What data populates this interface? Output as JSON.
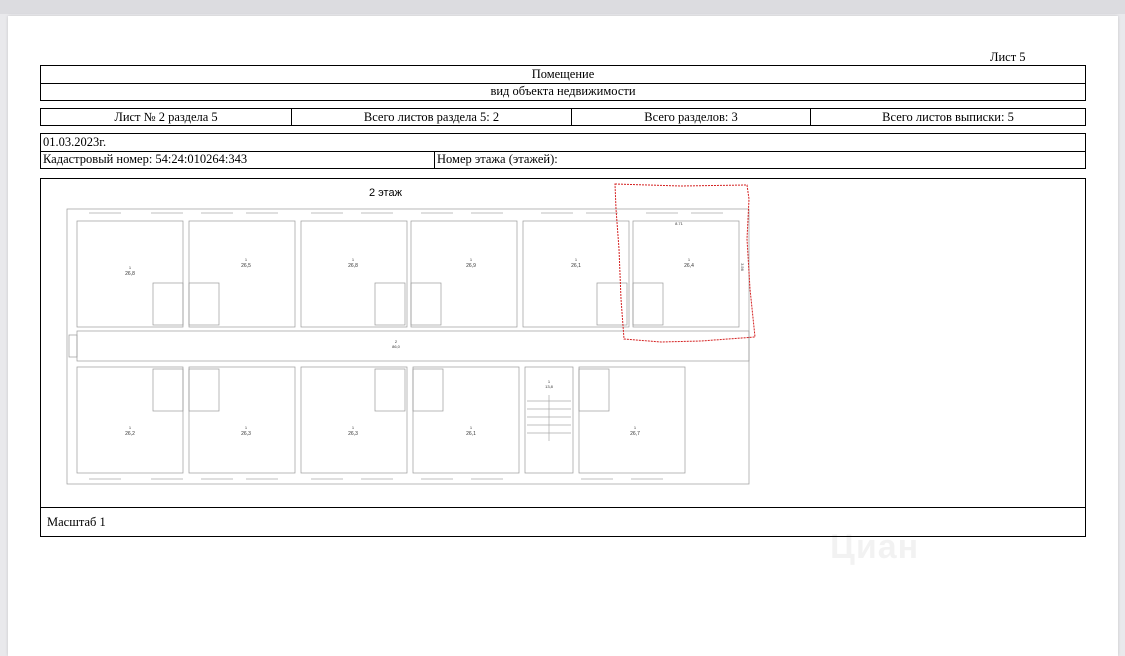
{
  "sheet_label": "Лист 5",
  "header": {
    "title": "Помещение",
    "subtitle": "вид объекта недвижимости"
  },
  "info_row": [
    "Лист № 2 раздела 5",
    "Всего листов раздела 5: 2",
    "Всего разделов: 3",
    "Всего листов выписки: 5"
  ],
  "date": "01.03.2023г.",
  "cadastral_number": "Кадастровый номер: 54:24:010264:343",
  "floor_number": "Номер этажа (этажей):",
  "plan": {
    "floor_title": "2 этаж",
    "top_rooms": [
      "26,8",
      "26,5",
      "26,8",
      "26,9",
      "26,1",
      "26,4"
    ],
    "bottom_rooms": [
      "26,2",
      "26,3",
      "26,3",
      "26,1",
      "26,7"
    ],
    "stair_area": "13,8",
    "corridor_area": "86,0",
    "highlight_dim_top": "8.71",
    "highlight_dim_side": "3.56",
    "highlight_color": "#d42020"
  },
  "scale": "Масштаб 1",
  "watermark": "Циан"
}
